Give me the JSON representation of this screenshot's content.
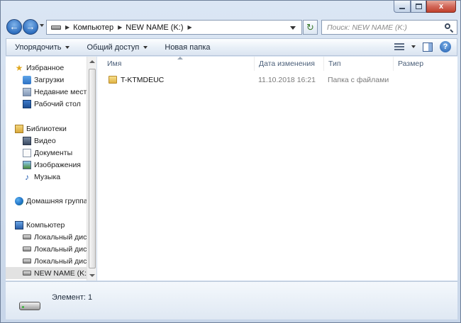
{
  "window": {
    "caption_buttons": {
      "close": "x"
    }
  },
  "navigation": {
    "back": "←",
    "forward": "→",
    "address": {
      "crumbs": [
        "Компьютер",
        "NEW NAME (K:)"
      ]
    },
    "search": {
      "placeholder": "Поиск: NEW NAME (K:)"
    }
  },
  "toolbar": {
    "organize": "Упорядочить",
    "share": "Общий доступ",
    "new_folder": "Новая папка"
  },
  "sidebar": {
    "favorites": {
      "header": "Избранное",
      "items": [
        "Загрузки",
        "Недавние места",
        "Рабочий стол"
      ]
    },
    "libraries": {
      "header": "Библиотеки",
      "items": [
        "Видео",
        "Документы",
        "Изображения",
        "Музыка"
      ]
    },
    "homegroup": "Домашняя группа",
    "computer": {
      "header": "Компьютер",
      "items": [
        "Локальный диск",
        "Локальный диск",
        "Локальный диск",
        "NEW NAME (K:)"
      ],
      "selected_index": 3
    }
  },
  "columns": {
    "name": "Имя",
    "date": "Дата изменения",
    "type": "Тип",
    "size": "Размер"
  },
  "files": [
    {
      "name": "T-KTMDEUC",
      "date": "11.10.2018 16:21",
      "type": "Папка с файлами",
      "size": ""
    }
  ],
  "status": {
    "text": "Элемент: 1"
  },
  "icons": {
    "star": "★",
    "music": "♪",
    "help": "?"
  }
}
